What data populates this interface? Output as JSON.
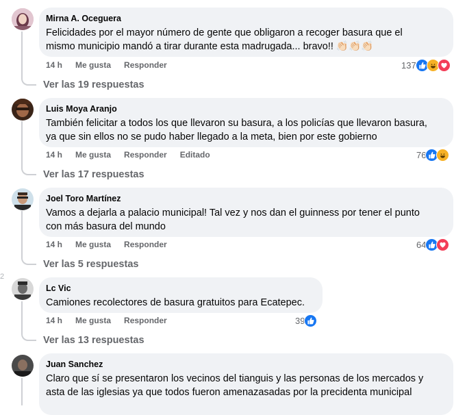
{
  "comments": [
    {
      "author": "Mirna A. Oceguera",
      "text": "Felicidades por el mayor número de gente que obligaron a recoger basura que el\nmismo municipio mandó a tirar durante esta madrugada... bravo!! 👏🏻👏🏻👏🏻",
      "time": "14 h",
      "like_label": "Me gusta",
      "reply_label": "Responder",
      "reaction_count": "137",
      "reactions": [
        "like",
        "haha",
        "love"
      ],
      "replies_label": "Ver las 19 respuestas"
    },
    {
      "author": "Luis Moya Aranjo",
      "text": "También felicitar a todos los que llevaron su basura, a los policías que llevaron basura,\nya que sin ellos no se pudo haber llegado a la meta, bien por este gobierno",
      "time": "14 h",
      "like_label": "Me gusta",
      "reply_label": "Responder",
      "edited_label": "Editado",
      "reaction_count": "76",
      "reactions": [
        "like",
        "haha"
      ],
      "replies_label": "Ver las 17 respuestas"
    },
    {
      "author": "Joel Toro Martínez",
      "text": "Vamos a dejarla a palacio municipal! Tal vez y nos dan el guinness por tener el punto\ncon más basura del mundo",
      "time": "14 h",
      "like_label": "Me gusta",
      "reply_label": "Responder",
      "reaction_count": "64",
      "reactions": [
        "like",
        "love"
      ],
      "replies_label": "Ver las 5 respuestas"
    },
    {
      "author": "Lc Vic",
      "text": "Camiones recolectores de basura gratuitos para Ecatepec.",
      "time": "14 h",
      "like_label": "Me gusta",
      "reply_label": "Responder",
      "reaction_count": "39",
      "reactions": [
        "like"
      ],
      "replies_label": "Ver las 13 respuestas"
    },
    {
      "author": "Juan Sanchez",
      "text": "Claro que sí se presentaron los vecinos del tianguis y las personas de los mercados y\nasta de las iglesias ya que todos fueron amenazasadas por la precidenta municipal"
    }
  ],
  "edge_marks": [
    "2"
  ],
  "colors": {
    "like": "#1877f2",
    "love": "#f33e58",
    "haha": "#f7b125",
    "bubble": "#f0f2f5",
    "meta": "#65676b"
  }
}
